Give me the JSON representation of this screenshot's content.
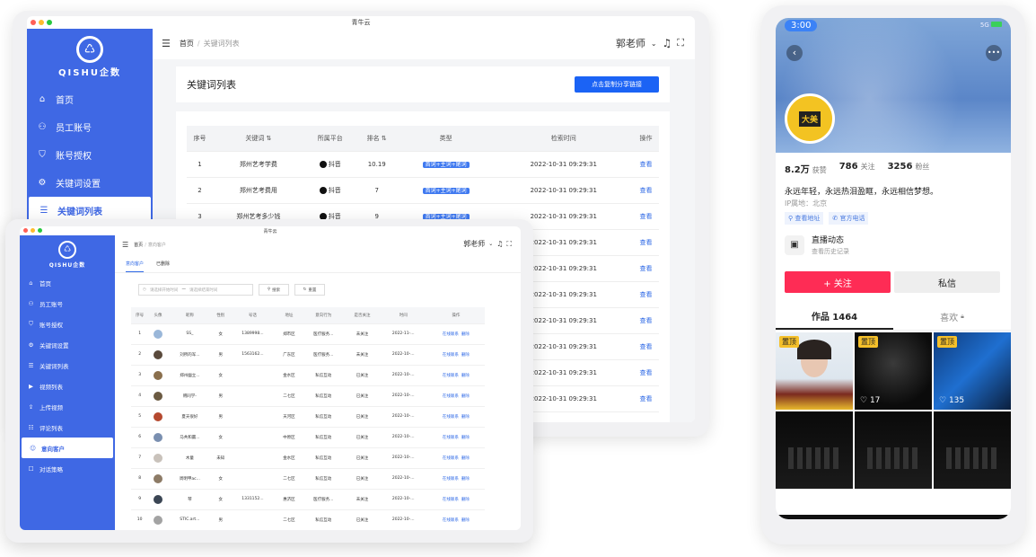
{
  "back_window": {
    "title": "青牛云",
    "logo_text": "QISHU企数",
    "nav": [
      {
        "icon": "home-icon",
        "glyph": "⌂",
        "label": "首页"
      },
      {
        "icon": "staff-icon",
        "glyph": "⚇",
        "label": "员工账号"
      },
      {
        "icon": "shield-icon",
        "glyph": "⛉",
        "label": "账号授权"
      },
      {
        "icon": "gear-icon",
        "glyph": "⚙",
        "label": "关键词设置"
      },
      {
        "icon": "list-icon",
        "glyph": "☰",
        "label": "关键词列表"
      }
    ],
    "breadcrumb": {
      "home": "首页",
      "sep": "/",
      "current": "关键词列表"
    },
    "user": "郭老师",
    "page_title": "关键词列表",
    "share_button": "点击复制分享链接",
    "table": {
      "headers": [
        "序号",
        "关键词 ⇅",
        "所属平台",
        "排名 ⇅",
        "类型",
        "检索时间",
        "操作"
      ],
      "rows": [
        [
          "1",
          "郑州艺考学费",
          "抖音",
          "10.19",
          "首词+主词+尾词",
          "2022-10-31 09:29:31",
          "查看"
        ],
        [
          "2",
          "郑州艺考费用",
          "抖音",
          "7",
          "首词+主词+尾词",
          "2022-10-31 09:29:31",
          "查看"
        ],
        [
          "3",
          "郑州艺考多少钱",
          "抖音",
          "9",
          "首词+主词+尾词",
          "2022-10-31 09:29:31",
          "查看"
        ],
        [
          "",
          "",
          "",
          "",
          "",
          "2022-10-31 09:29:31",
          "查看"
        ],
        [
          "",
          "",
          "",
          "",
          "",
          "2022-10-31 09:29:31",
          "查看"
        ],
        [
          "",
          "",
          "",
          "",
          "",
          "2022-10-31 09:29:31",
          "查看"
        ],
        [
          "",
          "",
          "",
          "",
          "",
          "2022-10-31 09:29:31",
          "查看"
        ],
        [
          "",
          "",
          "",
          "",
          "",
          "2022-10-31 09:29:31",
          "查看"
        ],
        [
          "",
          "",
          "",
          "",
          "",
          "2022-10-31 09:29:31",
          "查看"
        ],
        [
          "",
          "",
          "",
          "",
          "",
          "2022-10-31 09:29:31",
          "查看"
        ]
      ]
    }
  },
  "front_window": {
    "title": "青牛云",
    "logo_text": "QISHU企数",
    "nav": [
      {
        "icon": "home-icon",
        "glyph": "⌂",
        "label": "首页"
      },
      {
        "icon": "staff-icon",
        "glyph": "⚇",
        "label": "员工账号"
      },
      {
        "icon": "shield-icon",
        "glyph": "⛉",
        "label": "账号授权"
      },
      {
        "icon": "gear-icon",
        "glyph": "⚙",
        "label": "关键词设置"
      },
      {
        "icon": "list-icon",
        "glyph": "☰",
        "label": "关键词列表"
      },
      {
        "icon": "video-icon",
        "glyph": "▶",
        "label": "视频列表"
      },
      {
        "icon": "upload-icon",
        "glyph": "⇪",
        "label": "上传视频"
      },
      {
        "icon": "comment-icon",
        "glyph": "☷",
        "label": "评论列表"
      },
      {
        "icon": "customer-icon",
        "glyph": "☺",
        "label": "意向客户"
      },
      {
        "icon": "dialog-icon",
        "glyph": "☐",
        "label": "对话策略"
      }
    ],
    "breadcrumb": {
      "home": "首页",
      "sep": "/",
      "current": "意向客户"
    },
    "user": "郭老师",
    "tabs": [
      "意向客户",
      "已删除"
    ],
    "filter": {
      "start_placeholder": "请选择开始时间",
      "dash": "—",
      "end_placeholder": "请选择结束时间",
      "search": "搜索",
      "reset": "重置"
    },
    "table": {
      "headers": [
        "序号",
        "头像",
        "昵称",
        "性别",
        "号话",
        "地址",
        "意向行为",
        "是否关注",
        "时间",
        "操作"
      ],
      "rows": [
        {
          "no": "1",
          "avatar": "#9ab7d9",
          "name": "SS_",
          "gender": "女",
          "phone": "1389998...",
          "addr": "郑市区",
          "action": "医疗服务...",
          "follow": "未关注",
          "time": "2022-11-...",
          "op1": "在线联系",
          "op2": "删除"
        },
        {
          "no": "2",
          "avatar": "#5a4a3c",
          "name": "刘所的军...",
          "gender": "男",
          "phone": "1563162...",
          "addr": "广东区",
          "action": "医疗服务...",
          "follow": "未关注",
          "time": "2022-10-...",
          "op1": "在线联系",
          "op2": "删除"
        },
        {
          "no": "3",
          "avatar": "#8a6f4d",
          "name": "郑州幽立...",
          "gender": "女",
          "phone": "",
          "addr": "金水区",
          "action": "私信互动",
          "follow": "已关注",
          "time": "2022-10-...",
          "op1": "在线联系",
          "op2": "删除"
        },
        {
          "no": "4",
          "avatar": "#6b5a42",
          "name": "韩同学-",
          "gender": "男",
          "phone": "",
          "addr": "二七区",
          "action": "私信互动",
          "follow": "已关注",
          "time": "2022-10-...",
          "op1": "在线联系",
          "op2": "删除"
        },
        {
          "no": "5",
          "avatar": "#b5492f",
          "name": "夏天很好",
          "gender": "男",
          "phone": "",
          "addr": "天河区",
          "action": "私信互动",
          "follow": "已关注",
          "time": "2022-10-...",
          "op1": "在线联系",
          "op2": "删除"
        },
        {
          "no": "6",
          "avatar": "#7a8fb0",
          "name": "马共和赢...",
          "gender": "女",
          "phone": "",
          "addr": "中原区",
          "action": "私信互动",
          "follow": "已关注",
          "time": "2022-10-...",
          "op1": "在线联系",
          "op2": "删除"
        },
        {
          "no": "7",
          "avatar": "#c9c2bb",
          "name": "木童",
          "gender": "未知",
          "phone": "",
          "addr": "金水区",
          "action": "私信互动",
          "follow": "已关注",
          "time": "2022-10-...",
          "op1": "在线联系",
          "op2": "删除"
        },
        {
          "no": "8",
          "avatar": "#8d7b66",
          "name": "周明甲ac...",
          "gender": "女",
          "phone": "",
          "addr": "二七区",
          "action": "私信互动",
          "follow": "已关注",
          "time": "2022-10-...",
          "op1": "在线联系",
          "op2": "删除"
        },
        {
          "no": "9",
          "avatar": "#3b4654",
          "name": "琴",
          "gender": "女",
          "phone": "1331152...",
          "addr": "惠济区",
          "action": "医疗服务...",
          "follow": "未关注",
          "time": "2022-10-...",
          "op1": "在线联系",
          "op2": "删除"
        },
        {
          "no": "10",
          "avatar": "#a3a3a3",
          "name": "STIC.art...",
          "gender": "男",
          "phone": "",
          "addr": "二七区",
          "action": "私信互动",
          "follow": "已关注",
          "time": "2022-10-...",
          "op1": "在线联系",
          "op2": "删除"
        }
      ]
    }
  },
  "phone": {
    "time": "3:00",
    "signal": "5G",
    "avatar_text": "大美",
    "stats": [
      {
        "value": "8.2万",
        "label": "获赞"
      },
      {
        "value": "786",
        "label": "关注"
      },
      {
        "value": "3256",
        "label": "粉丝"
      }
    ],
    "bio": "永远年轻，永远热泪盈眶，永远相信梦想。",
    "ip": "IP属地：北京",
    "chips": [
      "查看地址",
      "官方电话"
    ],
    "live": {
      "title": "直播动态",
      "sub": "查看历史记录"
    },
    "follow_btn": "+ 关注",
    "msg_btn": "私信",
    "tabs": {
      "works": "作品 1464",
      "likes": "喜欢"
    },
    "thumbs": [
      {
        "pin": "置顶",
        "likes": ""
      },
      {
        "pin": "置顶",
        "likes": "17"
      },
      {
        "pin": "置顶",
        "likes": "135"
      },
      {
        "pin": "",
        "likes": ""
      },
      {
        "pin": "",
        "likes": ""
      },
      {
        "pin": "",
        "likes": ""
      }
    ],
    "colors": {
      "follow": "#fe2c55",
      "pin": "#f5c02a"
    }
  },
  "colors": {
    "sidebar": "#3f68e4",
    "primary": "#1b63f5",
    "tag": "#3f79f0"
  }
}
